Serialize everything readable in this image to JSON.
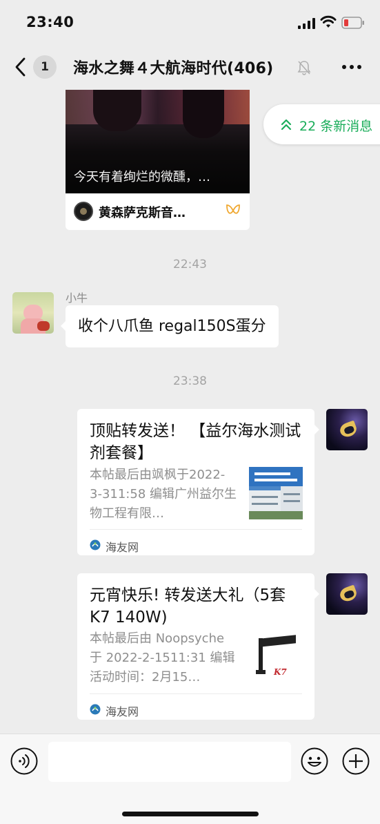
{
  "status_bar": {
    "time": "23:40"
  },
  "nav": {
    "unread_count": "1",
    "title": "海水之舞４大航海时代(406)"
  },
  "shared_channel_card": {
    "caption": "今天有着绚烂的微醺，…",
    "channel_name": "黄森萨克斯音…"
  },
  "new_messages": {
    "label": "22 条新消息",
    "color": "#1aad5a"
  },
  "timestamps": [
    "22:43",
    "23:38"
  ],
  "messages": [
    {
      "sender": "小牛",
      "text": "收个八爪鱼 regal150S蛋分"
    }
  ],
  "link_cards": [
    {
      "title": "顶贴转发送！ 【益尔海水测试剂套餐】",
      "description": "本帖最后由飒枫于2022-3-311:58 编辑广州益尔生物工程有限…",
      "source": "海友网"
    },
    {
      "title": "元宵快乐! 转发送大礼（5套 K7  140W)",
      "description": "本帖最后由 Noopsyche 于 2022-2-1511:31 编辑活动时间：2月15…",
      "source": "海友网"
    }
  ],
  "icons": {
    "back": "chevron-left-icon",
    "mute": "bell-slash-icon",
    "more": "ellipsis-icon",
    "voice": "voice-icon",
    "emoji": "emoji-icon",
    "plus": "plus-icon"
  }
}
